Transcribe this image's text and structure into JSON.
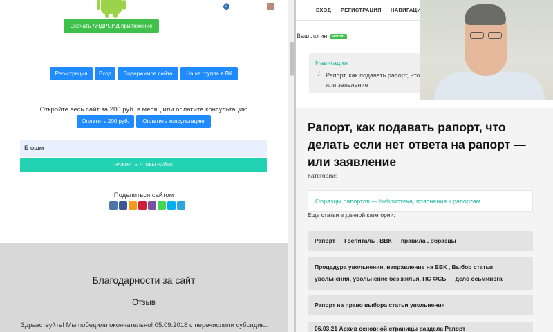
{
  "left": {
    "android_button": "Скачать АНДРОИД приложение",
    "top_badge": "2",
    "nav_buttons": [
      "Регистрация",
      "Вход",
      "Содержимое сайта",
      "Наша группа в ВК"
    ],
    "open_text": "Откройте весь сайт за 200 руб. в месяц или оплатите консультацию",
    "pay_buttons": [
      "Оплатить 200 руб.",
      "Оплатить консультацию"
    ],
    "search_value": "Б ошм",
    "search_button": "нажмите, чтобы найти",
    "share_label": "Поделиться сайтом",
    "share_icons": [
      {
        "name": "vk-icon",
        "color": "#4a76a8"
      },
      {
        "name": "facebook-icon",
        "color": "#3b5998"
      },
      {
        "name": "odnoklassniki-icon",
        "color": "#f59a16"
      },
      {
        "name": "moimir-icon",
        "color": "#d11d38"
      },
      {
        "name": "viber-icon",
        "color": "#7b519d"
      },
      {
        "name": "whatsapp-icon",
        "color": "#43d854"
      },
      {
        "name": "skype-icon",
        "color": "#00aff0"
      },
      {
        "name": "telegram-icon",
        "color": "#2ca5e0"
      }
    ],
    "thanks_title": "Благодарности за сайт",
    "review_title": "Отзыв",
    "review_text": "Здравствуйте! Мы победили окончательно! 05.09.2018 г. перечислили субсидию."
  },
  "right": {
    "nav": [
      "ВХОД",
      "РЕГИСТРАЦИЯ",
      "НАВИГАЦИ"
    ],
    "login_label": "Ваш логин:",
    "login_badge": "admin",
    "breadcrumb_nav": "Навигация",
    "breadcrumb_slash": "/",
    "breadcrumb_current": "Рапорт, как подавать рапорт, что",
    "breadcrumb_current_2": "или заявление",
    "article_title": "Рапорт, как подавать рапорт, что делать если нет ответа на рапорт — или заявление",
    "categories_label": "Категории:",
    "category_link": "Образцы рапортов — библиотека, пояснения к рапортам",
    "more_label": "Еще статьи в данной категории:",
    "articles": [
      "Рапорт — Госпиталь , ВВК — правила , образцы",
      "Процедура увольнения, направление на ВВК , Выбор статьи увольнения, увольнение без жилья, ПС ФСБ — дело осьминога",
      "Рапорт на право выбора статьи увольнения",
      "06.03.21 Архив основной страницы раздела Рапорт"
    ]
  },
  "colors": {
    "green": "#3ec04a",
    "blue": "#1f8bff",
    "teal": "#23d1b3",
    "link_teal": "#23b5a0"
  }
}
